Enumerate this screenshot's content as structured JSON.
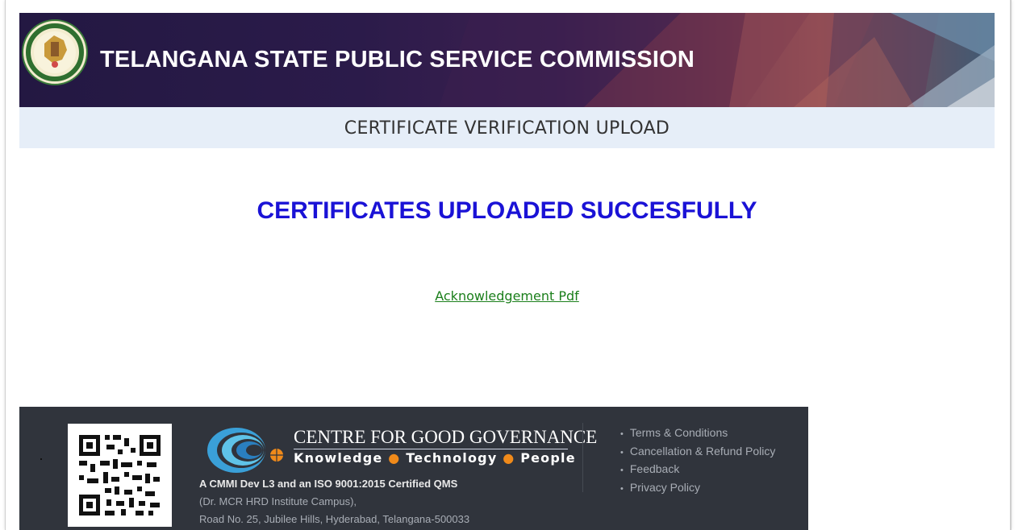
{
  "header": {
    "title": "TELANGANA STATE PUBLIC SERVICE COMMISSION",
    "logo_icon": "tspsc-emblem-icon"
  },
  "subheader": {
    "title": "CERTIFICATE VERIFICATION UPLOAD"
  },
  "main": {
    "success_message": "CERTIFICATES UPLOADED SUCCESFULLY",
    "ack_link": "Acknowledgement Pdf"
  },
  "footer": {
    "org_name": "CENTRE FOR GOOD GOVERNANCE",
    "tagline": {
      "word1": "Knowledge",
      "word2": "Technology",
      "word3": "People",
      "separator": "●"
    },
    "certification": "A CMMI Dev L3 and an ISO 9001:2015 Certified QMS",
    "address_line1": "(Dr. MCR HRD Institute Campus),",
    "address_line2": "Road No. 25, Jubilee Hills, Hyderabad, Telangana-500033",
    "links": [
      "Terms & Conditions",
      "Cancellation & Refund Policy",
      "Feedback",
      "Privacy Policy"
    ]
  },
  "colors": {
    "success": "#1a12d6",
    "link": "#1b7f1b",
    "footer_bg": "#30343c",
    "subheader_bg": "#e6eef8",
    "accent_orange": "#f08a1a"
  }
}
